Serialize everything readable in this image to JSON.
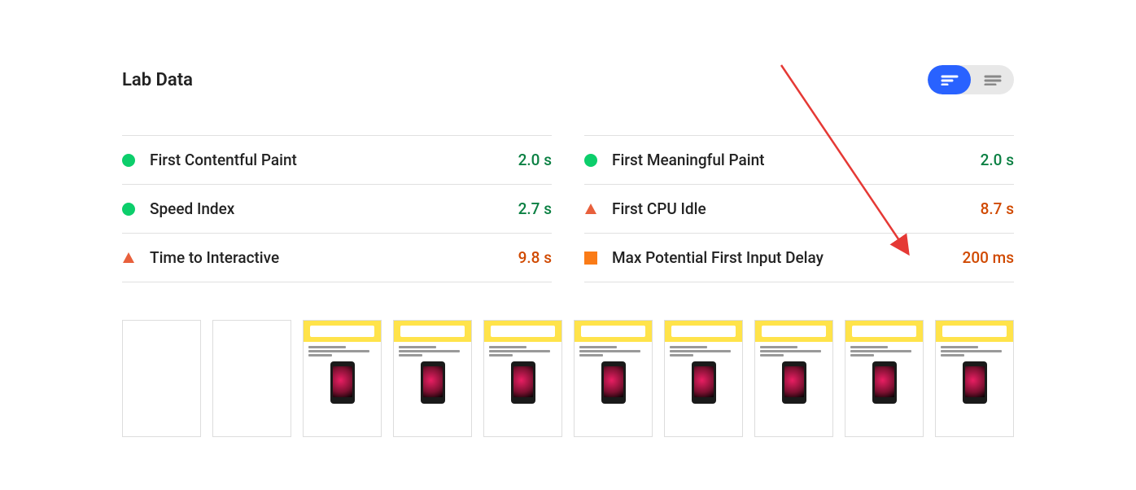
{
  "title": "Lab Data",
  "colors": {
    "pass": "#0b8043",
    "avg": "#d04900",
    "fail": "#d04900"
  },
  "metricsLeft": [
    {
      "icon": "pass",
      "label": "First Contentful Paint",
      "value": "2.0 s",
      "status": "pass"
    },
    {
      "icon": "pass",
      "label": "Speed Index",
      "value": "2.7 s",
      "status": "pass"
    },
    {
      "icon": "fail",
      "label": "Time to Interactive",
      "value": "9.8 s",
      "status": "fail"
    }
  ],
  "metricsRight": [
    {
      "icon": "pass",
      "label": "First Meaningful Paint",
      "value": "2.0 s",
      "status": "pass"
    },
    {
      "icon": "fail",
      "label": "First CPU Idle",
      "value": "8.7 s",
      "status": "fail"
    },
    {
      "icon": "avg",
      "label": "Max Potential First Input Delay",
      "value": "200 ms",
      "status": "fail"
    }
  ],
  "filmstripCount": 10,
  "blankThumbs": 2
}
